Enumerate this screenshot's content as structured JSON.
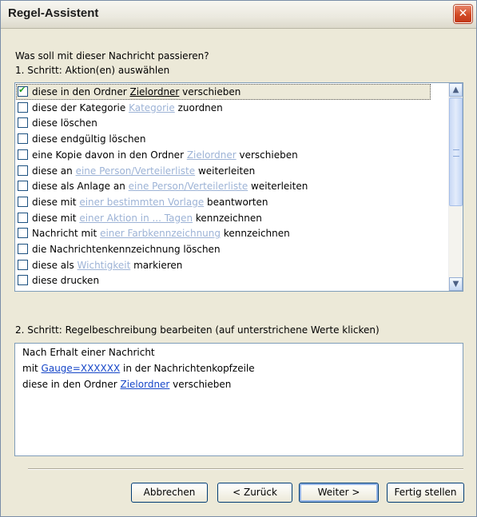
{
  "window": {
    "title": "Regel-Assistent"
  },
  "prompt": "Was soll mit dieser Nachricht passieren?",
  "step1_label": "1. Schritt: Aktion(en) auswählen",
  "actions": [
    {
      "checked": true,
      "pre": "diese in den Ordner ",
      "link": "Zielordner",
      "post": " verschieben",
      "link_active": true
    },
    {
      "checked": false,
      "pre": "diese der Kategorie ",
      "link": "Kategorie",
      "post": " zuordnen"
    },
    {
      "checked": false,
      "pre": "diese löschen",
      "link": "",
      "post": ""
    },
    {
      "checked": false,
      "pre": "diese endgültig löschen",
      "link": "",
      "post": ""
    },
    {
      "checked": false,
      "pre": "eine Kopie davon in den Ordner ",
      "link": "Zielordner",
      "post": " verschieben"
    },
    {
      "checked": false,
      "pre": "diese an ",
      "link": "eine Person/Verteilerliste",
      "post": " weiterleiten"
    },
    {
      "checked": false,
      "pre": "diese als Anlage an ",
      "link": "eine Person/Verteilerliste",
      "post": " weiterleiten"
    },
    {
      "checked": false,
      "pre": "diese mit ",
      "link": "einer bestimmten Vorlage",
      "post": " beantworten"
    },
    {
      "checked": false,
      "pre": "diese mit ",
      "link": "einer Aktion in ... Tagen",
      "post": " kennzeichnen"
    },
    {
      "checked": false,
      "pre": "Nachricht mit ",
      "link": "einer Farbkennzeichnung",
      "post": " kennzeichnen"
    },
    {
      "checked": false,
      "pre": "die Nachrichtenkennzeichnung löschen",
      "link": "",
      "post": ""
    },
    {
      "checked": false,
      "pre": "diese als ",
      "link": "Wichtigkeit",
      "post": " markieren"
    },
    {
      "checked": false,
      "pre": "diese drucken",
      "link": "",
      "post": ""
    }
  ],
  "step2_label": "2. Schritt: Regelbeschreibung bearbeiten (auf unterstrichene Werte klicken)",
  "description": {
    "line1": "Nach Erhalt einer Nachricht",
    "line2_pre": "mit ",
    "line2_link": "Gauge=XXXXXX",
    "line2_post": " in der Nachrichtenkopfzeile",
    "line3_pre": "diese in den Ordner ",
    "line3_link": "Zielordner",
    "line3_post": " verschieben"
  },
  "buttons": {
    "cancel": "Abbrechen",
    "back": "< Zurück",
    "next": "Weiter >",
    "finish": "Fertig stellen"
  },
  "icons": {
    "close": "close-icon",
    "check": "checkmark-icon",
    "scroll_up": "chevron-up-icon",
    "scroll_down": "chevron-down-icon"
  }
}
